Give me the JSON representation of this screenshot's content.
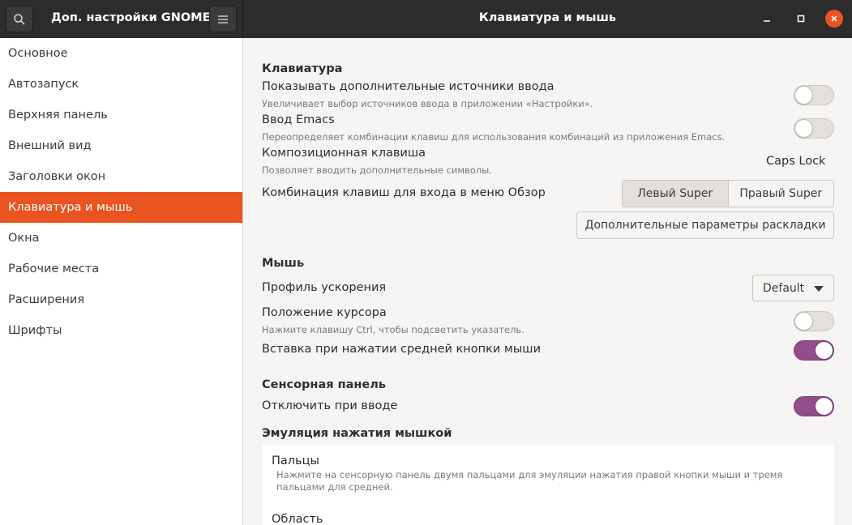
{
  "header": {
    "app_title": "Доп. настройки GNOME",
    "page_title": "Клавиатура и мышь"
  },
  "sidebar": {
    "items": [
      {
        "label": "Основное"
      },
      {
        "label": "Автозапуск"
      },
      {
        "label": "Верхняя панель"
      },
      {
        "label": "Внешний вид"
      },
      {
        "label": "Заголовки окон"
      },
      {
        "label": "Клавиатура и мышь",
        "active": true
      },
      {
        "label": "Окна"
      },
      {
        "label": "Рабочие места"
      },
      {
        "label": "Расширения"
      },
      {
        "label": "Шрифты"
      }
    ]
  },
  "keyboard": {
    "title": "Клавиатура",
    "extra_sources": {
      "label": "Показывать дополнительные источники ввода",
      "desc": "Увеличивает выбор источников ввода в приложении «Настройки».",
      "on": false
    },
    "emacs": {
      "label": "Ввод Emacs",
      "desc": "Переопределяет комбинации клавиш для использования комбинаций из приложения Emacs.",
      "on": false
    },
    "compose": {
      "label": "Композиционная клавиша",
      "desc": "Позволяет вводить дополнительные символы.",
      "value": "Caps Lock"
    },
    "overview": {
      "label": "Комбинация клавиш для входа в меню Обзор",
      "left": "Левый Super",
      "right": "Правый Super",
      "selected": "left"
    },
    "layout_button": "Дополнительные параметры раскладки"
  },
  "mouse": {
    "title": "Мышь",
    "accel": {
      "label": "Профиль ускорения",
      "value": "Default"
    },
    "cursor": {
      "label": "Положение курсора",
      "desc": "Нажмите клавишу Ctrl, чтобы подсветить указатель.",
      "on": false
    },
    "middle_paste": {
      "label": "Вставка при нажатии средней кнопки мыши",
      "on": true
    }
  },
  "touchpad": {
    "title": "Сенсорная панель",
    "disable_typing": {
      "label": "Отключить при вводе",
      "on": true
    }
  },
  "click_emulation": {
    "title": "Эмуляция нажатия мышкой",
    "fingers": {
      "label": "Пальцы",
      "desc": "Нажмите на сенсорную панель двумя пальцами для эмуляции нажатия правой кнопки мыши и тремя пальцами для средней."
    },
    "area": {
      "label": "Область"
    }
  },
  "colors": {
    "accent": "#e95420",
    "switch_on": "#924d8b",
    "headerbar": "#2c2c2c"
  }
}
